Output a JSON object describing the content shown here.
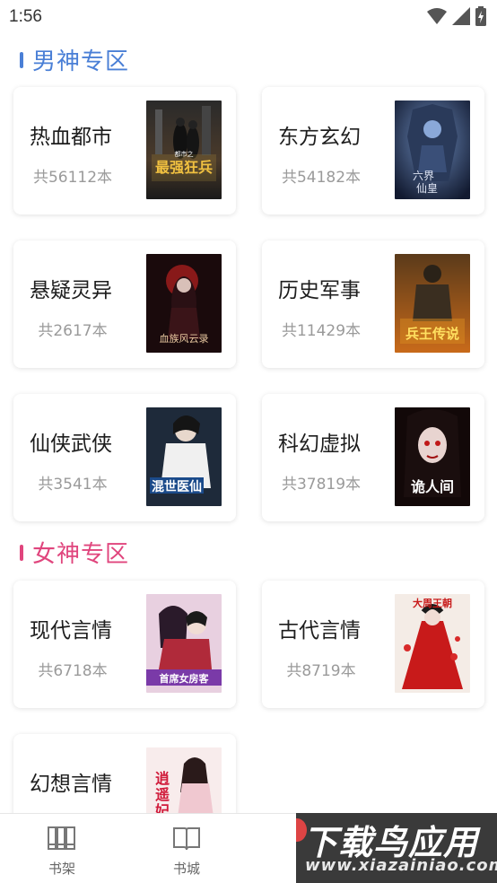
{
  "status": {
    "time": "1:56"
  },
  "sections": {
    "male": {
      "title": "男神专区",
      "color": "#4a7fd6"
    },
    "female": {
      "title": "女神专区",
      "color": "#e0457d"
    }
  },
  "categories": [
    {
      "name": "热血都市",
      "count": "共56112本",
      "cover": "最强狂兵"
    },
    {
      "name": "东方玄幻",
      "count": "共54182本",
      "cover": "六界仙皇"
    },
    {
      "name": "悬疑灵异",
      "count": "共2617本",
      "cover": "血族风云录"
    },
    {
      "name": "历史军事",
      "count": "共11429本",
      "cover": "兵王传说"
    },
    {
      "name": "仙侠武侠",
      "count": "共3541本",
      "cover": "混世医仙"
    },
    {
      "name": "科幻虚拟",
      "count": "共37819本",
      "cover": "诡人间"
    },
    {
      "name": "现代言情",
      "count": "共6718本",
      "cover": "首席女房客"
    },
    {
      "name": "古代言情",
      "count": "共8719本",
      "cover": "大周王朝"
    },
    {
      "name": "幻想言情",
      "count": "",
      "cover": "逍遥妃"
    }
  ],
  "nav": [
    {
      "label": "书架",
      "icon": "bookshelf-icon"
    },
    {
      "label": "书城",
      "icon": "bookstore-icon"
    }
  ],
  "watermark": {
    "main": "下载鸟应用",
    "sub": "www.xiazainiao.com"
  }
}
